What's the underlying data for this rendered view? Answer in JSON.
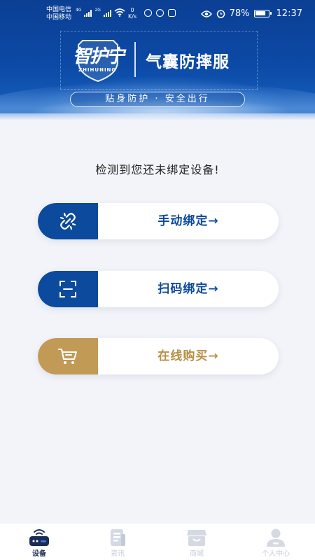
{
  "status_bar": {
    "carrier_1": "中国电信",
    "carrier_2": "中国移动",
    "net_1": "4G",
    "net_2": "2G",
    "speed_value": "0",
    "speed_unit": "K/s",
    "battery": "78%",
    "time": "12:37"
  },
  "banner": {
    "brand_cn": "智护宁",
    "brand_en": "ZHIHUNING",
    "product_name": "气囊防摔服",
    "slogan": "贴身防护 · 安全出行"
  },
  "main": {
    "prompt": "检测到您还未绑定设备!",
    "buttons": [
      {
        "label": "手动绑定→",
        "icon": "link-icon",
        "color": "#0c4a9e"
      },
      {
        "label": "扫码绑定→",
        "icon": "scan-icon",
        "color": "#0c4a9e"
      },
      {
        "label": "在线购买→",
        "icon": "cart-icon",
        "color": "#c19a55"
      }
    ]
  },
  "tabbar": {
    "tabs": [
      {
        "label": "设备",
        "icon": "device-icon",
        "active": true
      },
      {
        "label": "资讯",
        "icon": "news-icon",
        "active": false
      },
      {
        "label": "商城",
        "icon": "shop-icon",
        "active": false
      },
      {
        "label": "个人中心",
        "icon": "user-icon",
        "active": false
      }
    ]
  },
  "colors": {
    "primary": "#0c4a9e",
    "gold": "#c19a55",
    "background": "#f3f4f9"
  }
}
